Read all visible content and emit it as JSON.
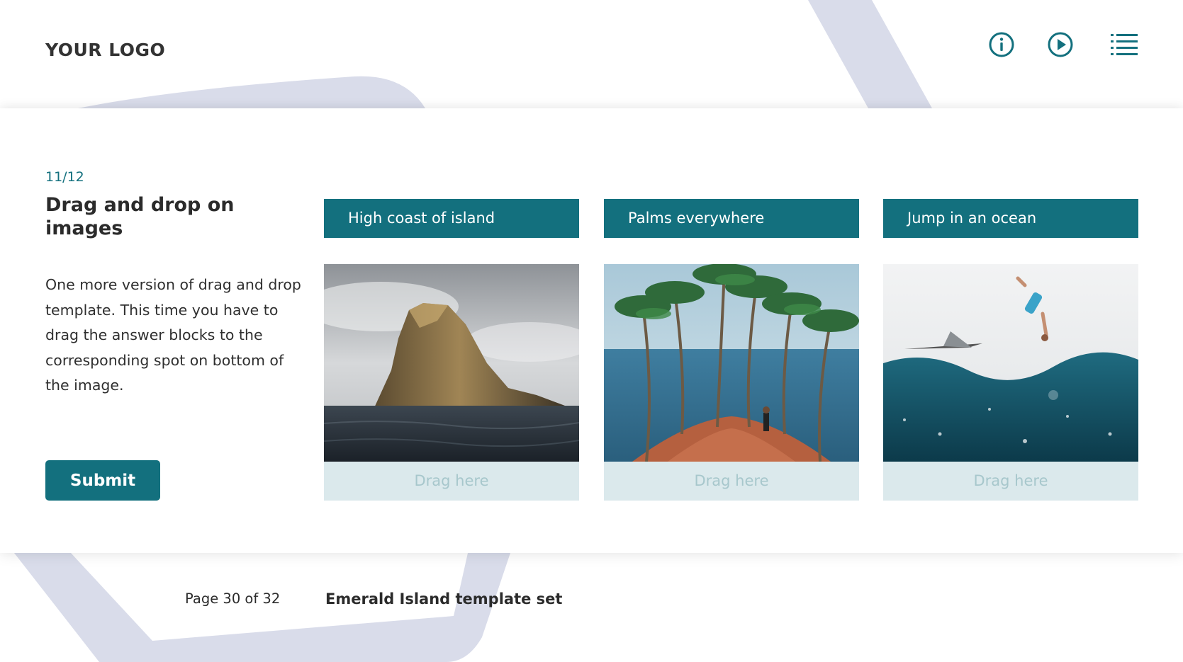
{
  "header": {
    "logo": "YOUR LOGO",
    "icons": [
      "info-icon",
      "play-icon",
      "menu-list-icon"
    ],
    "accent_color": "#13707e"
  },
  "question": {
    "progress": "11/12",
    "title": "Drag and drop on images",
    "description": "One more version of drag and drop template. This time you have to drag the answer blocks to the corresponding spot on bottom of the image.",
    "submit_label": "Submit"
  },
  "items": [
    {
      "answer": "High coast of island",
      "drop_label": "Drag here"
    },
    {
      "answer": "Palms everywhere",
      "drop_label": "Drag here"
    },
    {
      "answer": "Jump in an ocean",
      "drop_label": "Drag here"
    }
  ],
  "footer": {
    "page": "Page 30 of 32",
    "set_name": "Emerald Island template set"
  },
  "colors": {
    "accent": "#13707e",
    "drop_zone": "#dbe9ec",
    "drop_text": "#a7c7cc",
    "background_shape": "#d9dcea"
  }
}
